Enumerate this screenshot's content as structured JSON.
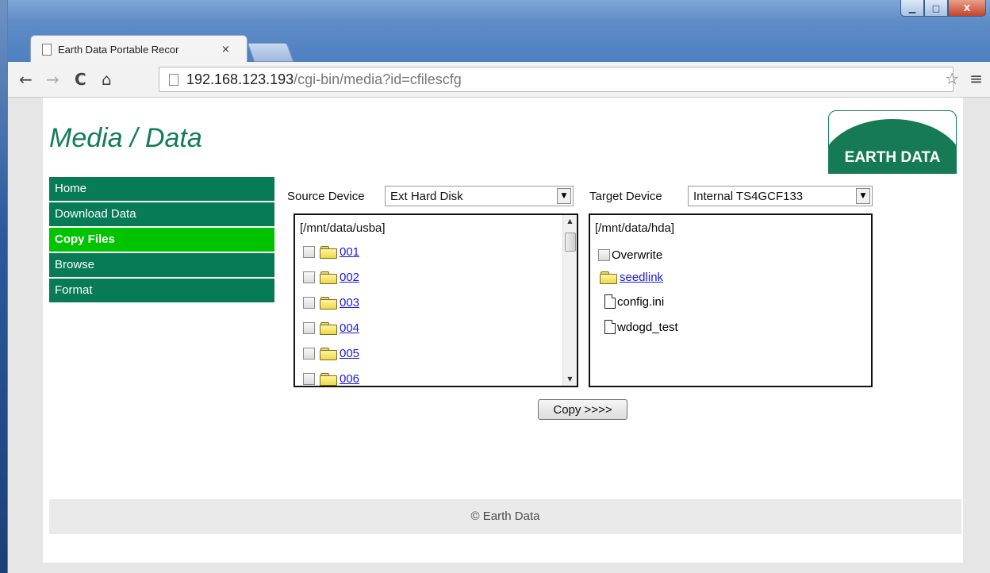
{
  "browser": {
    "tab_title": "Earth Data Portable Recor",
    "tab_close": "×",
    "url_host": "192.168.123.193",
    "url_path": "/cgi-bin/media?id=cfilescfg",
    "controls": {
      "minimize": "▁",
      "maximize": "□",
      "close": "X"
    }
  },
  "page": {
    "title": "Media / Data",
    "logo_text": "EARTH DATA",
    "footer": "© Earth Data"
  },
  "sidebar": {
    "items": [
      {
        "label": "Home",
        "active": false
      },
      {
        "label": "Download Data",
        "active": false
      },
      {
        "label": "Copy Files",
        "active": true
      },
      {
        "label": "Browse",
        "active": false
      },
      {
        "label": "Format",
        "active": false
      }
    ]
  },
  "source": {
    "label": "Source Device",
    "selected": "Ext Hard Disk",
    "path": "[/mnt/data/usba]",
    "folders": [
      "001",
      "002",
      "003",
      "004",
      "005",
      "006"
    ]
  },
  "target": {
    "label": "Target Device",
    "selected": "Internal TS4GCF133",
    "path": "[/mnt/data/hda]",
    "overwrite_label": "Overwrite",
    "folder": "seedlink",
    "files": [
      "config.ini",
      "wdogd_test"
    ]
  },
  "actions": {
    "copy": "Copy >>>>"
  }
}
